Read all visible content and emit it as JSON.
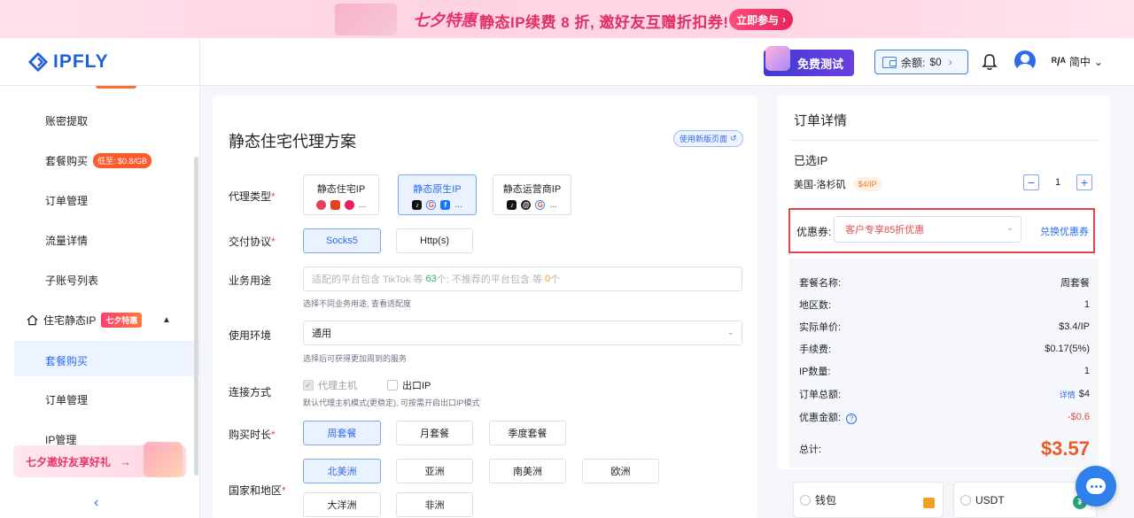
{
  "banner": {
    "brand": "七夕特惠",
    "text": "静态IP续费 8 折, 邀好友互赠折扣券!",
    "button": "立即参与"
  },
  "header": {
    "logo": "IPFLY",
    "free_test": "免费测试",
    "balance_label": "余额:",
    "balance_value": "$0",
    "language": "简中"
  },
  "sidebar": {
    "items": [
      {
        "label": "账密提取"
      },
      {
        "label": "套餐购买",
        "badge": "低至: $0.8/GB"
      },
      {
        "label": "订单管理"
      },
      {
        "label": "流量详情"
      },
      {
        "label": "子账号列表"
      }
    ],
    "group": {
      "label": "住宅静态IP",
      "badge": "七夕特惠"
    },
    "sub_items": [
      {
        "label": "套餐购买"
      },
      {
        "label": "订单管理"
      },
      {
        "label": "IP管理"
      }
    ],
    "invite": "七夕邀好友享好礼"
  },
  "main": {
    "title": "静态住宅代理方案",
    "new_page_btn": "使用新版页面",
    "proxy_type_label": "代理类型",
    "proxy_types": [
      "静态住宅IP",
      "静态原生IP",
      "静态运营商IP"
    ],
    "protocol_label": "交付协议",
    "protocols": [
      "Socks5",
      "Http(s)"
    ],
    "usage_label": "业务用途",
    "usage_placeholder_a": "适配的平台包含 TikTok 等",
    "usage_count_a": "63",
    "usage_placeholder_b": "个; 不推荐的平台包含 等",
    "usage_count_b": "0",
    "usage_placeholder_c": "个",
    "usage_hint": "选择不同业务用途, 查看适配度",
    "env_label": "使用环境",
    "env_value": "通用",
    "env_hint": "选择后可获得更加周到的服务",
    "conn_label": "连接方式",
    "conn_options": [
      "代理主机",
      "出口IP"
    ],
    "conn_hint": "默认代理主机模式(更稳定), 可按需开启出口IP模式",
    "duration_label": "购买时长",
    "durations": [
      "周套餐",
      "月套餐",
      "季度套餐"
    ],
    "region_label": "国家和地区",
    "regions": [
      "北美洲",
      "亚洲",
      "南美洲",
      "欧洲",
      "大洋洲",
      "非洲"
    ]
  },
  "order": {
    "title": "订单详情",
    "selected_title": "已选IP",
    "location": "美国-洛杉矶",
    "price_tag": "$4/IP",
    "quantity": "1",
    "coupon_label": "优惠券:",
    "coupon_value": "客户专享85折优惠",
    "coupon_link": "兑换优惠券",
    "rows": [
      {
        "label": "套餐名称:",
        "value": "周套餐"
      },
      {
        "label": "地区数:",
        "value": "1"
      },
      {
        "label": "实际单价:",
        "value": "$3.4/IP"
      },
      {
        "label": "手续费:",
        "value": "$0.17(5%)"
      },
      {
        "label": "IP数量:",
        "value": "1"
      }
    ],
    "total_order_label": "订单总额:",
    "total_order_link": "详情",
    "total_order_value": "$4",
    "discount_label": "优惠金额:",
    "discount_value": "-$0.6",
    "total_label": "总计:",
    "total_value": "$3.57"
  },
  "payment": [
    "钱包",
    "USDT"
  ]
}
